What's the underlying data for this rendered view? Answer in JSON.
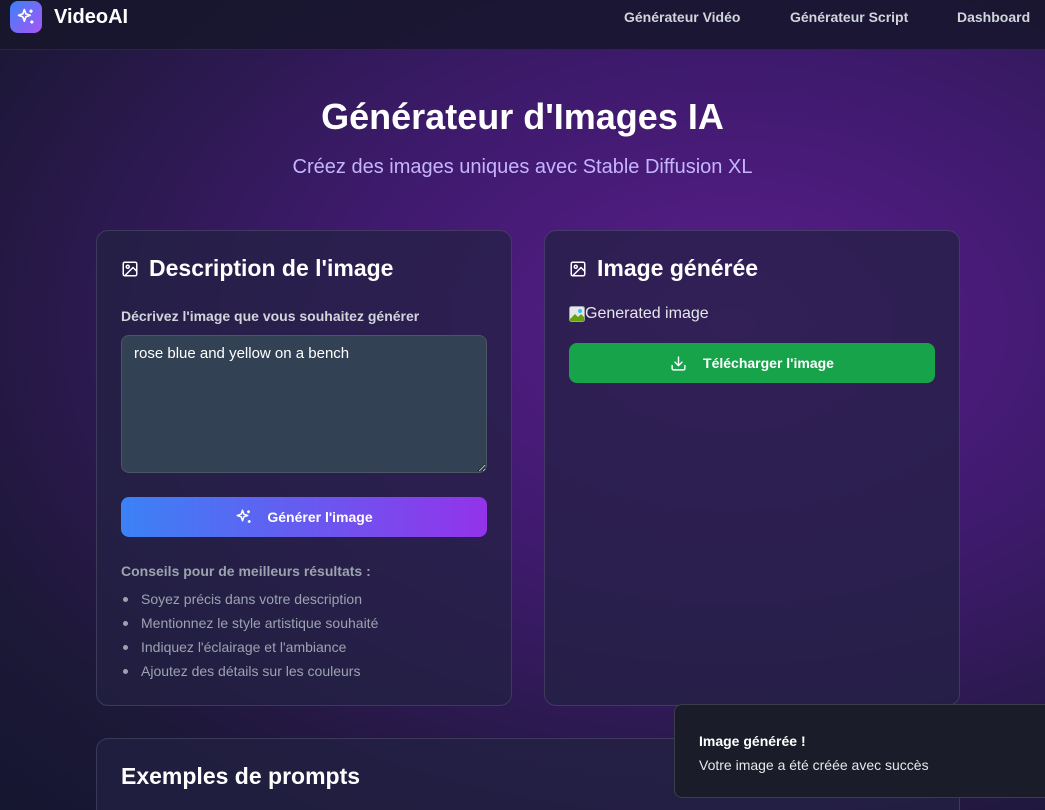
{
  "app": {
    "brand": "VideoAI"
  },
  "nav": {
    "items": [
      {
        "label": "Générateur Vidéo"
      },
      {
        "label": "Générateur Script"
      },
      {
        "label": "Dashboard"
      }
    ]
  },
  "hero": {
    "title": "Générateur d'Images IA",
    "subtitle": "Créez des images uniques avec Stable Diffusion XL"
  },
  "description_card": {
    "title": "Description de l'image",
    "field_label": "Décrivez l'image que vous souhaitez générer",
    "prompt_value": "rose blue and yellow on a bench",
    "generate_label": "Générer l'image",
    "tips_title": "Conseils pour de meilleurs résultats :",
    "tips": [
      "Soyez précis dans votre description",
      "Mentionnez le style artistique souhaité",
      "Indiquez l'éclairage et l'ambiance",
      "Ajoutez des détails sur les couleurs"
    ]
  },
  "result_card": {
    "title": "Image générée",
    "image_alt": "Generated image",
    "download_label": "Télécharger l'image"
  },
  "examples_card": {
    "title": "Exemples de prompts"
  },
  "toast": {
    "title": "Image générée !",
    "message": "Votre image a été créée avec succès"
  },
  "icons": {
    "logo": "sparkles-icon",
    "card": "image-icon",
    "generate": "sparkles-icon",
    "download": "download-icon"
  },
  "colors": {
    "accent_blue": "#3b82f6",
    "accent_purple": "#9333ea",
    "success_green": "#16a34a",
    "input_bg": "#334155"
  }
}
